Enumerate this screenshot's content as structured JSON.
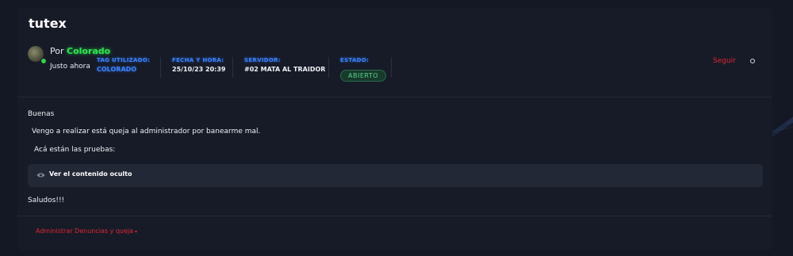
{
  "thread": {
    "title": "tutex"
  },
  "post": {
    "by_prefix": "Por",
    "author": "Colorado",
    "time": "Justo ahora",
    "meta": [
      {
        "label": "TAG UTILIZADO:",
        "value": "COLORADO"
      },
      {
        "label": "FECHA Y HORA:",
        "value": "25/10/23 20:39"
      },
      {
        "label": "SERVIDOR:",
        "value": "#02 MATA AL TRAIDOR"
      }
    ],
    "status": {
      "label": "ESTADO:",
      "value": "ABIERTO"
    },
    "follow_label": "Seguir",
    "body": {
      "greeting": "Buenas",
      "line1": "Vengo a realizar está queja al administrador por banearme mal.",
      "line2": "Acá están las pruebas:",
      "hidden_content_label": "Ver el contenido oculto",
      "closing": "Saludos!!!"
    }
  },
  "footer": {
    "admin_link": "Administrar Denuncias y queja",
    "admin_caret": "▾"
  },
  "colors": {
    "accent_red": "#e0262f",
    "author_green": "#2ee44e",
    "meta_blue": "#3a82ff",
    "status_green": "#58d68a"
  },
  "icons": {
    "hidden_content": "eye-icon",
    "more_options": "circle-icon"
  }
}
